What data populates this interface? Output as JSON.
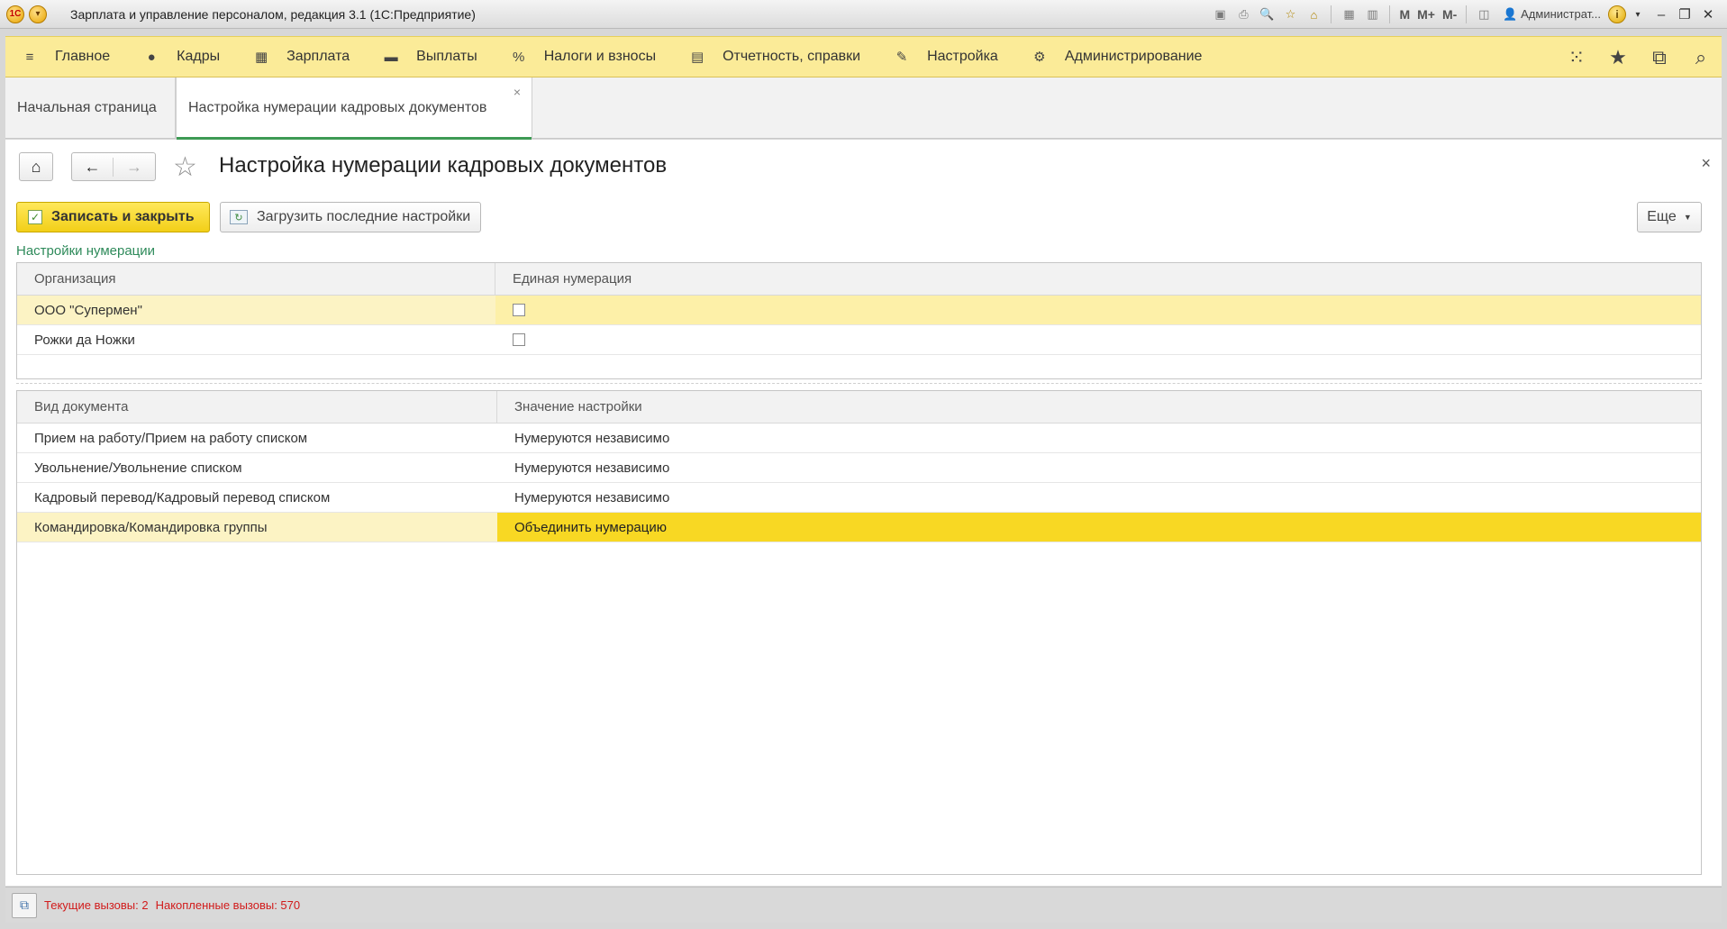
{
  "window": {
    "title": "Зарплата и управление персоналом, редакция 3.1  (1С:Предприятие)",
    "logo_text": "1С",
    "user": "Администрат...",
    "m_labels": [
      "M",
      "M+",
      "M-"
    ]
  },
  "sections": [
    {
      "name": "main",
      "label": "Главное",
      "icon": "menu-icon",
      "glyph": "≡"
    },
    {
      "name": "kadry",
      "label": "Кадры",
      "icon": "people-icon",
      "glyph": "👥"
    },
    {
      "name": "zarplata",
      "label": "Зарплата",
      "icon": "calculator-icon",
      "glyph": "▦"
    },
    {
      "name": "vyplaty",
      "label": "Выплаты",
      "icon": "wallet-icon",
      "glyph": "▬"
    },
    {
      "name": "nalogi",
      "label": "Налоги и взносы",
      "icon": "percent-icon",
      "glyph": "%"
    },
    {
      "name": "otchetnost",
      "label": "Отчетность, справки",
      "icon": "report-icon",
      "glyph": "▤"
    },
    {
      "name": "nastroyka",
      "label": "Настройка",
      "icon": "wrench-icon",
      "glyph": "🔧"
    },
    {
      "name": "admin",
      "label": "Администрирование",
      "icon": "gear-icon",
      "glyph": "⚙"
    }
  ],
  "tabs": {
    "home": "Начальная страница",
    "active": "Настройка нумерации кадровых документов"
  },
  "form": {
    "title": "Настройка нумерации кадровых документов",
    "save_close": "Записать и закрыть",
    "load_last": "Загрузить последние настройки",
    "more": "Еще",
    "group_title": "Настройки нумерации"
  },
  "orgs_table": {
    "headers": [
      "Организация",
      "Единая нумерация"
    ],
    "rows": [
      {
        "org": "ООО \"Супермен\"",
        "unified": false
      },
      {
        "org": "Рожки да Ножки",
        "unified": false
      }
    ]
  },
  "docs_table": {
    "headers": [
      "Вид документа",
      "Значение настройки"
    ],
    "rows": [
      {
        "doc": "Прием на работу/Прием на работу списком",
        "value": "Нумеруются независимо"
      },
      {
        "doc": "Увольнение/Увольнение списком",
        "value": "Нумеруются независимо"
      },
      {
        "doc": "Кадровый перевод/Кадровый перевод списком",
        "value": "Нумеруются независимо"
      },
      {
        "doc": "Командировка/Командировка группы",
        "value": "Объединить нумерацию"
      }
    ]
  },
  "status": {
    "current_calls": "Текущие вызовы: 2",
    "accumulated_calls": "Накопленные вызовы: 570"
  },
  "colors": {
    "section_bg": "#fbeb98",
    "primary_button": "#f2cf18",
    "selected_cell": "#f8d823",
    "group_title": "#2e8a5a",
    "status_text": "#d11b1b"
  }
}
